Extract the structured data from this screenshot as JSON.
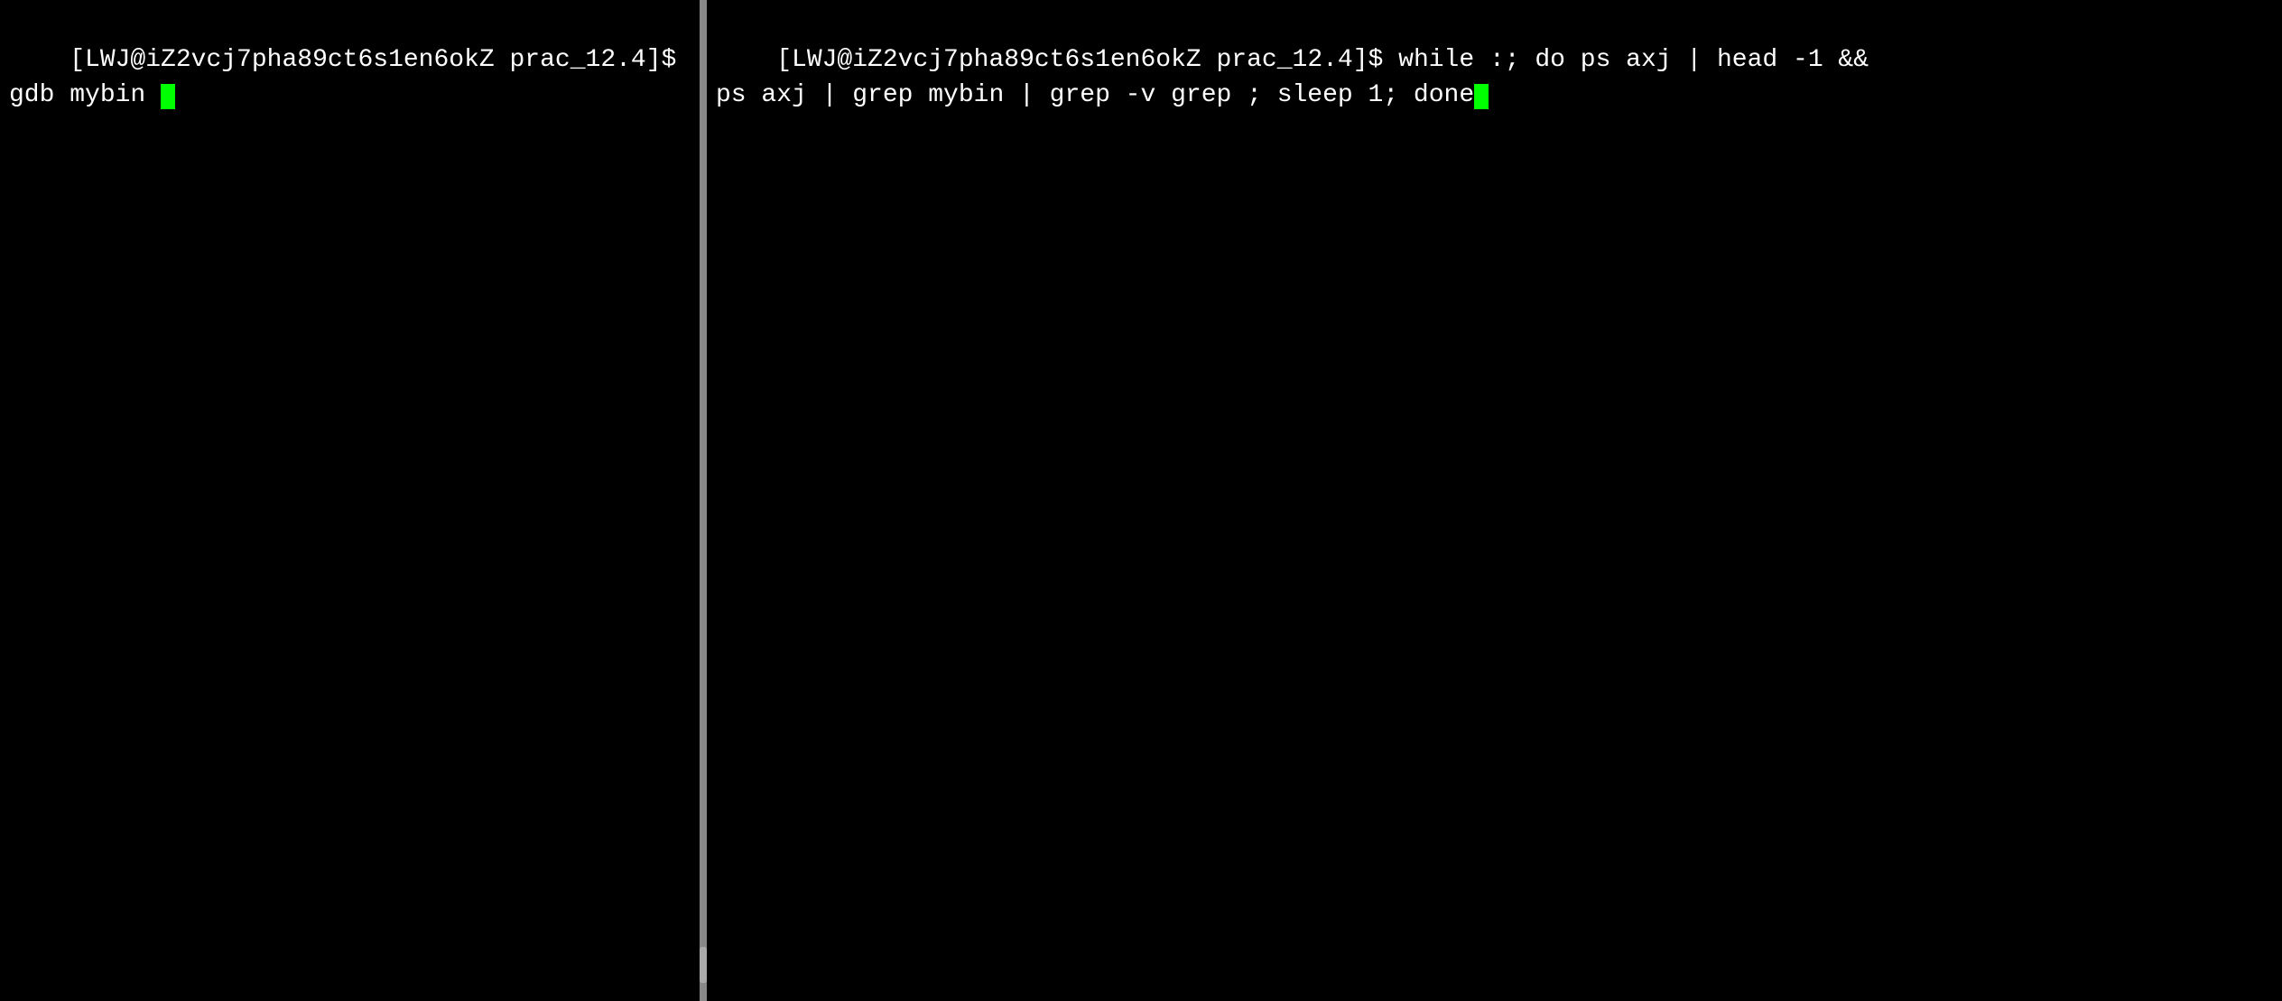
{
  "left_pane": {
    "prompt": "[LWJ@iZ2vcj7pha89ct6s1en6okZ prac_12.4]$ ",
    "command": "gdb mybin "
  },
  "right_pane": {
    "prompt": "[LWJ@iZ2vcj7pha89ct6s1en6okZ prac_12.4]$ ",
    "command": "while :; do ps axj | head -1 &&\nps axj | grep mybin | grep -v grep ; sleep 1; done"
  }
}
